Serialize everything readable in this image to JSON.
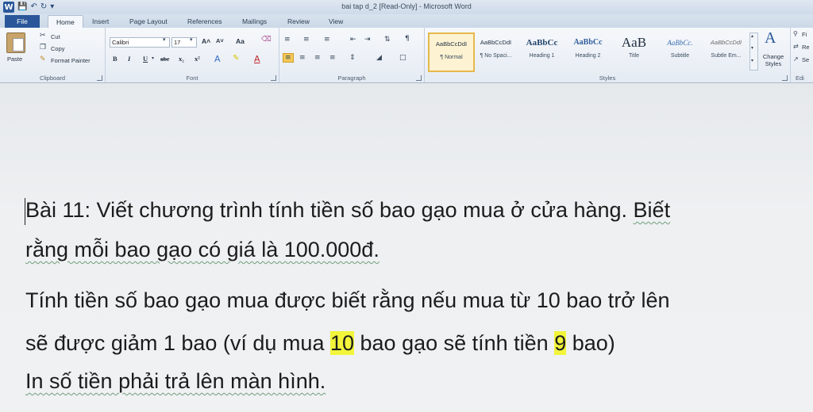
{
  "window": {
    "title": "bai tap d_2 [Read-Only] - Microsoft Word",
    "app_icon": "W"
  },
  "quick_access": {
    "save_icon": "save-icon",
    "undo_icon": "undo-icon",
    "redo_icon": "redo-icon"
  },
  "tabs": [
    {
      "label": "File"
    },
    {
      "label": "Home"
    },
    {
      "label": "Insert"
    },
    {
      "label": "Page Layout"
    },
    {
      "label": "References"
    },
    {
      "label": "Mailings"
    },
    {
      "label": "Review"
    },
    {
      "label": "View"
    }
  ],
  "ribbon": {
    "clipboard": {
      "group_label": "Clipboard",
      "paste": "Paste",
      "cut": "Cut",
      "copy": "Copy",
      "format_painter": "Format Painter"
    },
    "font": {
      "group_label": "Font",
      "font_name": "Calibri",
      "font_size": "17",
      "grow": "A˄",
      "shrink": "A˅",
      "change_case": "Aa",
      "bold": "B",
      "italic": "I",
      "underline": "U",
      "strike": "abc",
      "subscript": "x₂",
      "superscript": "x²"
    },
    "paragraph": {
      "group_label": "Paragraph",
      "pilcrow": "¶"
    },
    "styles": {
      "group_label": "Styles",
      "items": [
        {
          "sample": "AaBbCcDdI",
          "name": "¶ Normal"
        },
        {
          "sample": "AaBbCcDdI",
          "name": "¶ No Spaci..."
        },
        {
          "sample": "AaBbCc",
          "name": "Heading 1"
        },
        {
          "sample": "AaBbCc",
          "name": "Heading 2"
        },
        {
          "sample": "AaB",
          "name": "Title"
        },
        {
          "sample": "AaBbCc.",
          "name": "Subtitle"
        },
        {
          "sample": "AaBbCcDdI",
          "name": "Subtle Em..."
        }
      ],
      "change_styles": "Change Styles"
    },
    "editing": {
      "group_label": "Edi",
      "find": "Fi",
      "replace": "Re",
      "select": "Se"
    }
  },
  "document": {
    "line1_a": "Bài 11: Viết chương trình tính tiền số bao gạo mua ở cửa hàng. ",
    "line1_b": "Biết",
    "line2": "rằng mỗi bao gạo có giá là 100.000đ.",
    "line3": "Tính tiền số bao gạo mua được biết rằng nếu mua từ 10 bao trở lên",
    "line4_a": "sẽ được giảm 1 bao (ví dụ mua ",
    "line4_hl1": "10",
    "line4_b": " bao gạo sẽ tính tiền ",
    "line4_hl2": "9",
    "line4_c": " bao)",
    "line5": "In số tiền phải trả lên màn hình.",
    "highlight_color": "#f2f53a"
  }
}
